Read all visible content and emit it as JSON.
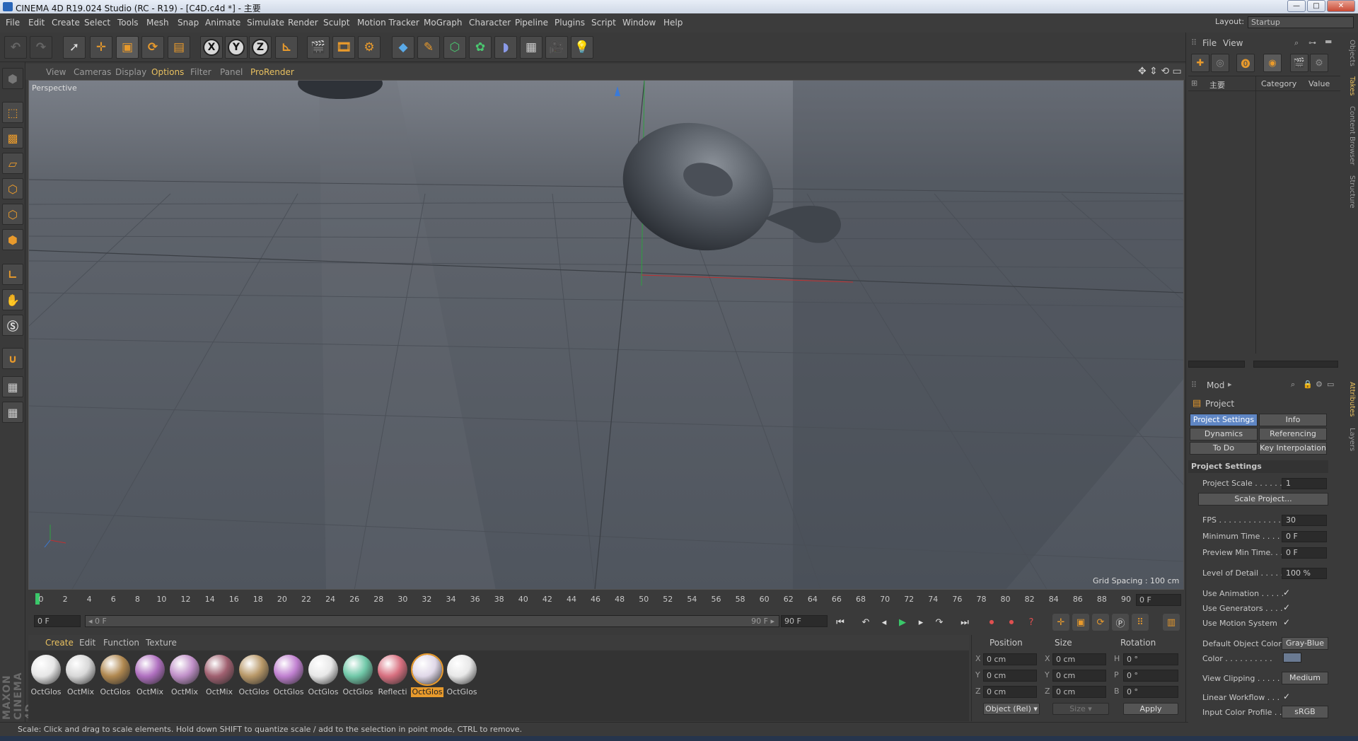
{
  "title": "CINEMA 4D R19.024 Studio (RC - R19) - [C4D.c4d *] - 主要",
  "window_controls": [
    "—",
    "□",
    "✕"
  ],
  "layout": {
    "label": "Layout:",
    "value": "Startup"
  },
  "menu": [
    "File",
    "Edit",
    "Create",
    "Select",
    "Tools",
    "Mesh",
    "Snap",
    "Animate",
    "Simulate",
    "Render",
    "Sculpt",
    "Motion Tracker",
    "MoGraph",
    "Character",
    "Pipeline",
    "Plugins",
    "Script",
    "Window",
    "Help"
  ],
  "toolbar_icons": [
    "undo-icon",
    "redo-icon",
    "live-select-icon",
    "move-icon",
    "scale-icon",
    "rotate-icon",
    "last-tool-icon",
    "x-axis-icon",
    "y-axis-icon",
    "z-axis-icon",
    "coordinate-system-icon",
    "render-view-icon",
    "render-picture-viewer-icon",
    "edit-render-settings-icon",
    "cube-icon",
    "pen-icon",
    "subdivision-icon",
    "cloner-icon",
    "deformer-icon",
    "floor-icon",
    "camera-icon",
    "light-icon"
  ],
  "axis_letters": [
    "X",
    "Y",
    "Z"
  ],
  "viewport": {
    "menu": [
      "View",
      "Cameras",
      "Display",
      "Options",
      "Filter",
      "Panel",
      "ProRender"
    ],
    "camera_label": "Perspective",
    "grid_spacing": "Grid Spacing : 100 cm"
  },
  "timeline": {
    "ticks": [
      "0",
      "2",
      "4",
      "6",
      "8",
      "10",
      "12",
      "14",
      "16",
      "18",
      "20",
      "22",
      "24",
      "26",
      "28",
      "30",
      "32",
      "34",
      "36",
      "38",
      "40",
      "42",
      "44",
      "46",
      "48",
      "50",
      "52",
      "54",
      "56",
      "58",
      "60",
      "62",
      "64",
      "66",
      "68",
      "70",
      "72",
      "74",
      "76",
      "78",
      "80",
      "82",
      "84",
      "86",
      "88",
      "90"
    ],
    "current_frame": "0 F",
    "start_field": "0 F",
    "range_start": "◂ 0 F",
    "range_end": "90 F ▸",
    "end_field": "90 F"
  },
  "materials": {
    "menu": [
      "Create",
      "Edit",
      "Function",
      "Texture"
    ],
    "items": [
      {
        "label": "OctGlos",
        "color": "#e6e6e6"
      },
      {
        "label": "OctMix",
        "color": "#d8d8d8"
      },
      {
        "label": "OctGlos",
        "color": "#b08850"
      },
      {
        "label": "OctMix",
        "color": "#b070c0"
      },
      {
        "label": "OctMix",
        "color": "#c090c8"
      },
      {
        "label": "OctMix",
        "color": "#a06070"
      },
      {
        "label": "OctGlos",
        "color": "#b89868"
      },
      {
        "label": "OctGlos",
        "color": "#c080d0"
      },
      {
        "label": "OctGlos",
        "color": "#e8e8e8"
      },
      {
        "label": "OctGlos",
        "color": "#70c8a8"
      },
      {
        "label": "Reflecti",
        "color": "#d87080"
      },
      {
        "label": "OctGlos",
        "color": "#e0d8e8",
        "selected": true
      },
      {
        "label": "OctGlos",
        "color": "#e8e8e8"
      }
    ]
  },
  "coordinates": {
    "headers": [
      "Position",
      "Size",
      "Rotation"
    ],
    "pos_labels": [
      "X",
      "Y",
      "Z"
    ],
    "size_labels": [
      "X",
      "Y",
      "Z"
    ],
    "rot_labels": [
      "H",
      "P",
      "B"
    ],
    "pos": [
      "0 cm",
      "0 cm",
      "0 cm"
    ],
    "size": [
      "0 cm",
      "0 cm",
      "0 cm"
    ],
    "rot": [
      "0 °",
      "0 °",
      "0 °"
    ],
    "mode": "Object (Rel)",
    "size_mode": "Size",
    "apply": "Apply"
  },
  "status": "Scale: Click and drag to scale elements. Hold down SHIFT to quantize scale / add to the selection in point mode, CTRL to remove.",
  "brand": "MAXON CINEMA 4D",
  "right_panel": {
    "menu": [
      "File",
      "View"
    ],
    "takes": {
      "root": "主要",
      "col_category": "Category",
      "col_value": "Value"
    },
    "side_tabs": [
      "Objects",
      "Takes",
      "Content Browser",
      "Structure"
    ],
    "attr_side_tabs": [
      "Attributes",
      "Layers"
    ],
    "attr_menu": "Mod",
    "object": "Project",
    "tabs": [
      "Project Settings",
      "Info",
      "Dynamics",
      "Referencing",
      "To Do",
      "Key Interpolation"
    ],
    "section": "Project Settings",
    "rows": [
      {
        "label": "Project Scale . . . . . .",
        "value": "1"
      },
      {
        "label": "FPS . . . . . . . . . . . . . .",
        "value": "30"
      },
      {
        "label": "Minimum Time . . . . .",
        "value": "0 F"
      },
      {
        "label": "Preview Min Time. . .",
        "value": "0 F"
      },
      {
        "label": "Level of Detail . . . . .",
        "value": "100 %"
      }
    ],
    "scale_project_btn": "Scale Project...",
    "checks": [
      "Use Animation . . . . .",
      "Use Generators . . . .",
      "Use Motion System"
    ],
    "default_color_label": "Default Object Color",
    "default_color_value": "Gray-Blue",
    "color_label": "Color . . . . . . . . . .",
    "view_clipping_label": "View Clipping . . . . .",
    "view_clipping_value": "Medium",
    "linear_workflow": "Linear Workflow . . .",
    "input_color_label": "Input Color Profile . .",
    "input_color_value": "sRGB"
  }
}
